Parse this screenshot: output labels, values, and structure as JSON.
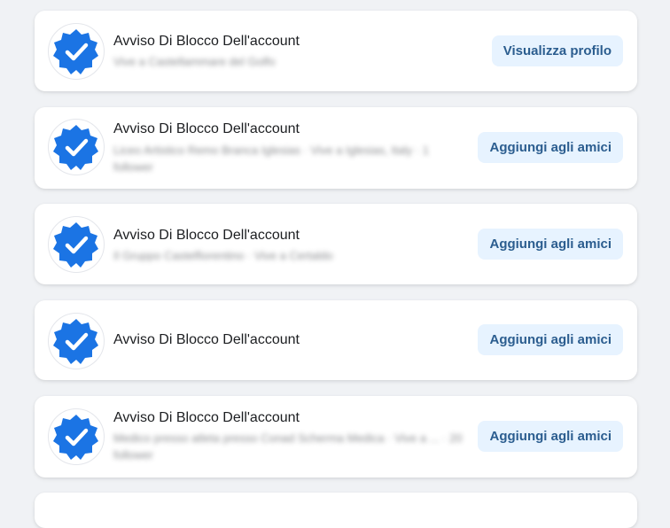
{
  "accent_color": "#1b74e4",
  "button_bg": "#e7f3ff",
  "button_text_color": "#2b5d8f",
  "cards": [
    {
      "name": "Avviso Di Blocco Dell'account",
      "subtitle": "Vive a Castellammare del Golfo",
      "button": "Visualizza profilo",
      "avatar_icon": "verified-badge-icon"
    },
    {
      "name": "Avviso Di Blocco Dell'account",
      "subtitle": "Liceo Artistico Remo Branca Iglesias · Vive a Iglesias, Italy · 1 follower",
      "button": "Aggiungi agli amici",
      "avatar_icon": "verified-badge-icon"
    },
    {
      "name": "Avviso Di Blocco Dell'account",
      "subtitle": "Il Gruppo Castelfiorentino · Vive a Certaldo",
      "button": "Aggiungi agli amici",
      "avatar_icon": "verified-badge-icon"
    },
    {
      "name": "Avviso Di Blocco Dell'account",
      "subtitle": "",
      "button": "Aggiungi agli amici",
      "avatar_icon": "verified-badge-icon"
    },
    {
      "name": "Avviso Di Blocco Dell'account",
      "subtitle": "Medico presso atleta presso Conad Scherma Medica · Vive a ... · 20 follower",
      "button": "Aggiungi agli amici",
      "avatar_icon": "verified-badge-icon"
    }
  ]
}
